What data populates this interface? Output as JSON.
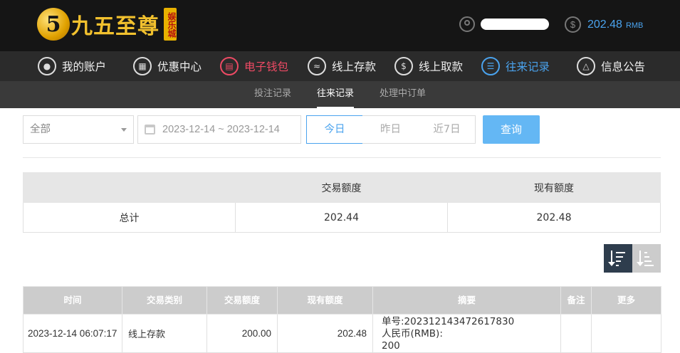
{
  "brand": {
    "logo_mark": "5",
    "name": "九五至尊",
    "tag": "娱乐城"
  },
  "header": {
    "balance_symbol": "$",
    "balance": "202.48",
    "currency": "RMB"
  },
  "nav": {
    "items": [
      {
        "label": "我的账户",
        "icon": "user-icon"
      },
      {
        "label": "优惠中心",
        "icon": "gift-icon"
      },
      {
        "label": "电子钱包",
        "icon": "wallet-icon"
      },
      {
        "label": "线上存款",
        "icon": "deposit-icon"
      },
      {
        "label": "线上取款",
        "icon": "withdraw-icon"
      },
      {
        "label": "往来记录",
        "icon": "records-icon"
      },
      {
        "label": "信息公告",
        "icon": "bell-icon"
      }
    ]
  },
  "subnav": {
    "items": [
      {
        "label": "投注记录"
      },
      {
        "label": "往来记录"
      },
      {
        "label": "处理中订单"
      }
    ]
  },
  "filters": {
    "type_select": "全部",
    "date_range": "2023-12-14 ~ 2023-12-14",
    "quick": [
      "今日",
      "昨日",
      "近7日"
    ],
    "search_label": "查询"
  },
  "summary": {
    "headers": [
      "",
      "交易额度",
      "现有额度"
    ],
    "row": {
      "label": "总计",
      "trade": "202.44",
      "current": "202.48"
    }
  },
  "records": {
    "headers": [
      "时间",
      "交易类别",
      "交易额度",
      "现有额度",
      "摘要",
      "备注",
      "更多"
    ],
    "rows": [
      {
        "time": "2023-12-14 06:07:17",
        "type": "线上存款",
        "amount": "200.00",
        "balance": "202.48",
        "summary_lines": [
          "单号:202312143472617830",
          "人民币(RMB):",
          "200"
        ],
        "note": "",
        "more": ""
      }
    ]
  },
  "colors": {
    "accent_blue": "#4aa3ee",
    "accent_red": "#ee4a64",
    "gold": "#f2c12e"
  }
}
